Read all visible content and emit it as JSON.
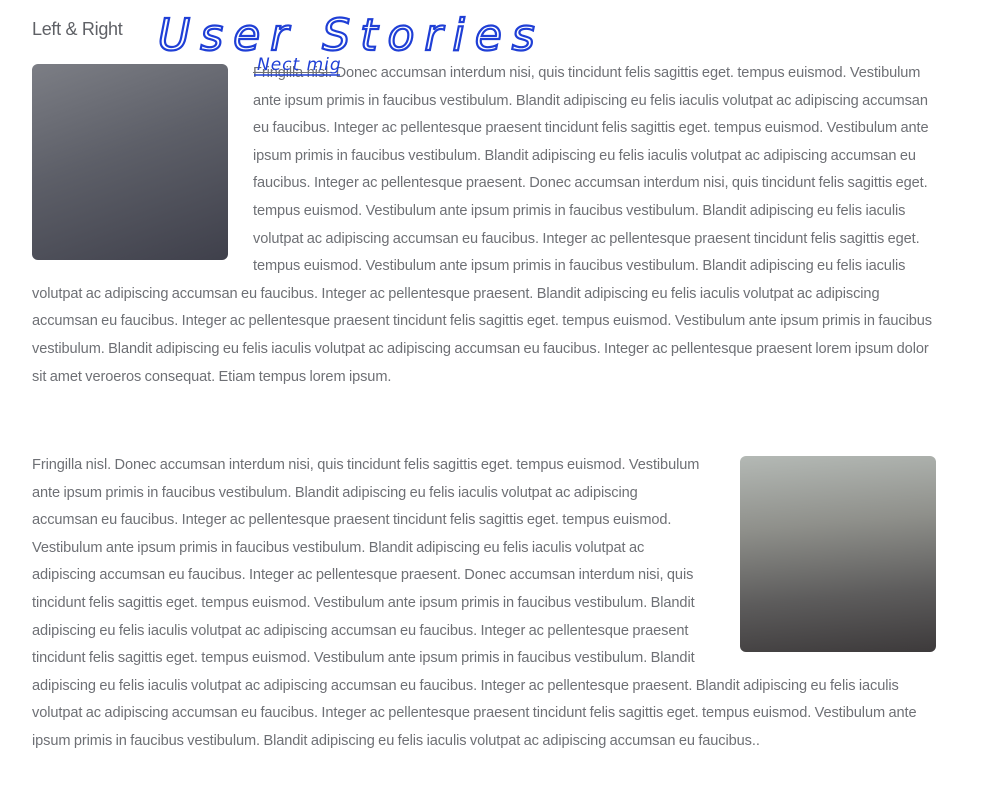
{
  "section": {
    "title": "Left & Right"
  },
  "annotations": {
    "title_note": "User Stories",
    "insert_note": "Nect mig"
  },
  "block_one": {
    "struck_words": "Fringilla nisl.",
    "text": " Donec accumsan interdum nisi, quis tincidunt felis sagittis eget. tempus euismod. Vestibulum ante ipsum primis in faucibus vestibulum. Blandit adipiscing eu felis iaculis volutpat ac adipiscing accumsan eu faucibus. Integer ac pellentesque praesent tincidunt felis sagittis eget. tempus euismod. Vestibulum ante ipsum primis in faucibus vestibulum. Blandit adipiscing eu felis iaculis volutpat ac adipiscing accumsan eu faucibus. Integer ac pellentesque praesent. Donec accumsan interdum nisi, quis tincidunt felis sagittis eget. tempus euismod. Vestibulum ante ipsum primis in faucibus vestibulum. Blandit adipiscing eu felis iaculis volutpat ac adipiscing accumsan eu faucibus. Integer ac pellentesque praesent tincidunt felis sagittis eget. tempus euismod. Vestibulum ante ipsum primis in faucibus vestibulum. Blandit adipiscing eu felis iaculis volutpat ac adipiscing accumsan eu faucibus. Integer ac pellentesque praesent. Blandit adipiscing eu felis iaculis volutpat ac adipiscing accumsan eu faucibus. Integer ac pellentesque praesent tincidunt felis sagittis eget. tempus euismod. Vestibulum ante ipsum primis in faucibus vestibulum. Blandit adipiscing eu felis iaculis volutpat ac adipiscing accumsan eu faucibus. Integer ac pellentesque praesent lorem ipsum dolor sit amet veroeros consequat. Etiam tempus lorem ipsum."
  },
  "block_two": {
    "text": "Fringilla nisl. Donec accumsan interdum nisi, quis tincidunt felis sagittis eget. tempus euismod. Vestibulum ante ipsum primis in faucibus vestibulum. Blandit adipiscing eu felis iaculis volutpat ac adipiscing accumsan eu faucibus. Integer ac pellentesque praesent tincidunt felis sagittis eget. tempus euismod. Vestibulum ante ipsum primis in faucibus vestibulum. Blandit adipiscing eu felis iaculis volutpat ac adipiscing accumsan eu faucibus. Integer ac pellentesque praesent. Donec accumsan interdum nisi, quis tincidunt felis sagittis eget. tempus euismod. Vestibulum ante ipsum primis in faucibus vestibulum. Blandit adipiscing eu felis iaculis volutpat ac adipiscing accumsan eu faucibus. Integer ac pellentesque praesent tincidunt felis sagittis eget. tempus euismod. Vestibulum ante ipsum primis in faucibus vestibulum. Blandit adipiscing eu felis iaculis volutpat ac adipiscing accumsan eu faucibus. Integer ac pellentesque praesent. Blandit adipiscing eu felis iaculis volutpat ac adipiscing accumsan eu faucibus. Integer ac pellentesque praesent tincidunt felis sagittis eget. tempus euismod. Vestibulum ante ipsum primis in faucibus vestibulum. Blandit adipiscing eu felis iaculis volutpat ac adipiscing accumsan eu faucibus.."
  },
  "colors": {
    "ink": "#1f3fd6",
    "body_text": "#6e7075",
    "title_text": "#5f6166"
  }
}
